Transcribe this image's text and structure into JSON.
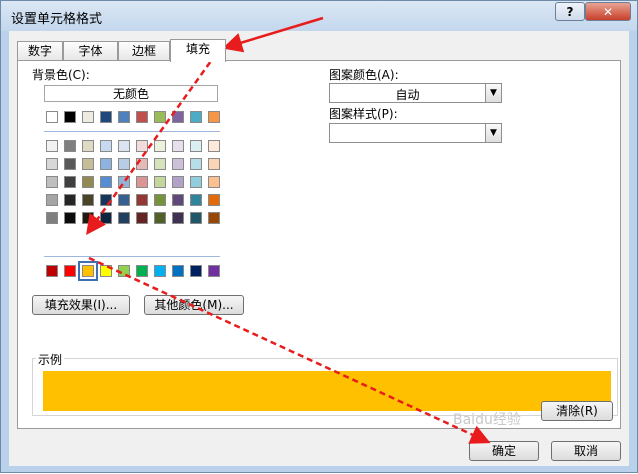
{
  "window": {
    "title": "设置单元格格式",
    "help_label": "?",
    "close_label": "✕"
  },
  "tabs": [
    {
      "label": "数字"
    },
    {
      "label": "字体"
    },
    {
      "label": "边框"
    },
    {
      "label": "填充",
      "active": true
    }
  ],
  "fill": {
    "background_label": "背景色(C):",
    "no_color_label": "无颜色",
    "theme_row": [
      "#ffffff",
      "#000000",
      "#eeece1",
      "#1f497d",
      "#4f81bd",
      "#c0504d",
      "#9bbb59",
      "#8064a2",
      "#4bacc6",
      "#f79646"
    ],
    "tint_rows": [
      [
        "#f2f2f2",
        "#7f7f7f",
        "#ddd9c3",
        "#c6d9f0",
        "#dbe5f1",
        "#f2dcdb",
        "#ebf1dd",
        "#e5e0ec",
        "#dbeef3",
        "#fdeada"
      ],
      [
        "#d8d8d8",
        "#595959",
        "#c4bd97",
        "#8db3e2",
        "#b8cce4",
        "#e5b9b7",
        "#d7e3bc",
        "#ccc1d9",
        "#b7dde8",
        "#fbd5b5"
      ],
      [
        "#bfbfbf",
        "#3f3f3f",
        "#938953",
        "#548dd4",
        "#95b3d7",
        "#d99694",
        "#c3d69b",
        "#b2a2c7",
        "#92cddc",
        "#fac08f"
      ],
      [
        "#a5a5a5",
        "#262626",
        "#494429",
        "#17365d",
        "#366092",
        "#953734",
        "#76923c",
        "#5f497a",
        "#31859b",
        "#e36c09"
      ],
      [
        "#7f7f7f",
        "#0c0c0c",
        "#1d1b10",
        "#0f243e",
        "#244061",
        "#632423",
        "#4f6128",
        "#3f3151",
        "#205867",
        "#974806"
      ]
    ],
    "standard_row": [
      "#c00000",
      "#ff0000",
      "#ffc000",
      "#ffff00",
      "#92d050",
      "#00b050",
      "#00b0f0",
      "#0070c0",
      "#002060",
      "#7030a0"
    ],
    "selected_color": "#ffc000",
    "fill_effects_label": "填充效果(I)...",
    "more_colors_label": "其他颜色(M)...",
    "pattern_color_label": "图案颜色(A):",
    "pattern_color_value": "自动",
    "pattern_style_label": "图案样式(P):",
    "pattern_style_value": ""
  },
  "sample": {
    "label": "示例",
    "color": "#ffc000"
  },
  "buttons": {
    "clear_label": "清除(R)",
    "ok_label": "确定",
    "cancel_label": "取消"
  },
  "annotation_color": "#e81c1c",
  "watermark": "Baidu经验"
}
